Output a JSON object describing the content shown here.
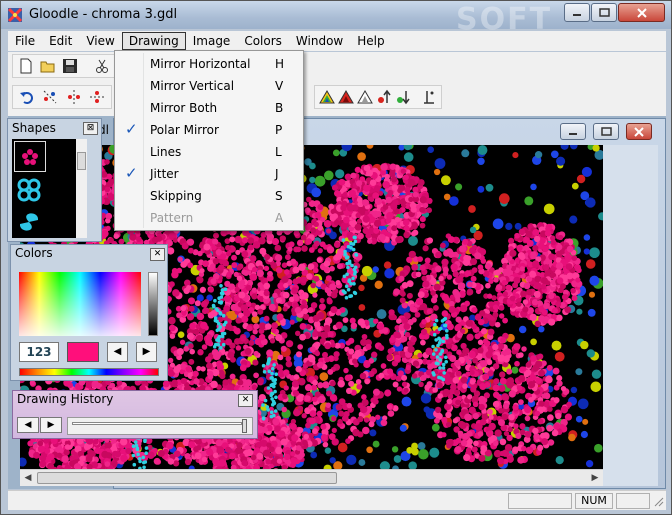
{
  "window": {
    "title": "Gloodle - chroma 3.gdl",
    "watermark": "SOFT"
  },
  "menubar": [
    {
      "label": "File"
    },
    {
      "label": "Edit"
    },
    {
      "label": "View"
    },
    {
      "label": "Drawing"
    },
    {
      "label": "Image"
    },
    {
      "label": "Colors"
    },
    {
      "label": "Window"
    },
    {
      "label": "Help"
    }
  ],
  "drawing_menu": [
    {
      "label": "Mirror Horizontal",
      "key": "H",
      "checked": false,
      "enabled": true
    },
    {
      "label": "Mirror Vertical",
      "key": "V",
      "checked": false,
      "enabled": true
    },
    {
      "label": "Mirror Both",
      "key": "B",
      "checked": false,
      "enabled": true
    },
    {
      "label": "Polar Mirror",
      "key": "P",
      "checked": true,
      "enabled": true
    },
    {
      "label": "Lines",
      "key": "L",
      "checked": false,
      "enabled": true
    },
    {
      "label": "Jitter",
      "key": "J",
      "checked": true,
      "enabled": true
    },
    {
      "label": "Skipping",
      "key": "S",
      "checked": false,
      "enabled": true
    },
    {
      "label": "Pattern",
      "key": "A",
      "checked": false,
      "enabled": false
    }
  ],
  "child_window": {
    "title": "dl"
  },
  "palettes": {
    "shapes": {
      "title": "Shapes",
      "close": "⊠"
    },
    "colors": {
      "title": "Colors",
      "close": "✕",
      "value": "123",
      "swatch": "#ff0f7b"
    },
    "history": {
      "title": "Drawing History",
      "close": "✕"
    }
  },
  "status": {
    "num": "NUM"
  },
  "colors": {
    "accent_pink": "#e8107a",
    "menu_highlight": "#1c58b8"
  }
}
